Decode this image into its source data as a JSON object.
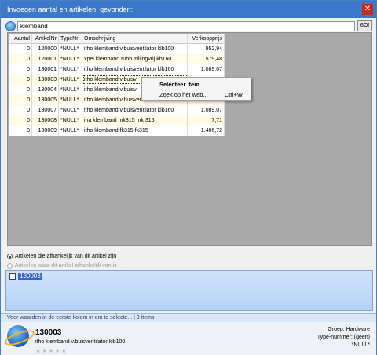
{
  "window": {
    "title": "Invoegen aantal en artikelen, gevonden:",
    "close_glyph": "✕"
  },
  "search": {
    "value": "klemband",
    "go_label": "GO!"
  },
  "table": {
    "columns": [
      "Aantal",
      "ArtikelNr",
      "TypeNr",
      "Omschrijving",
      "Verkoopprijs"
    ],
    "rows": [
      {
        "aantal": "0",
        "artikelnr": "120000",
        "typenr": "*NULL*",
        "omschrijving": "itho klemband v.buisventilator klb100",
        "prijs": "952,94"
      },
      {
        "aantal": "0",
        "artikelnr": "120001",
        "typenr": "*NULL*",
        "omschrijving": "xpel klemband rubb.trillingvrij kb160",
        "prijs": "579,48"
      },
      {
        "aantal": "0",
        "artikelnr": "130001",
        "typenr": "*NULL*",
        "omschrijving": "itho klemband v.buisventilator klb160",
        "prijs": "1.089,07"
      },
      {
        "aantal": "0",
        "artikelnr": "130003",
        "typenr": "*NULL*",
        "omschrijving": "itho klemband v.buisv",
        "prijs": ""
      },
      {
        "aantal": "0",
        "artikelnr": "130004",
        "typenr": "*NULL*",
        "omschrijving": "itho klemband v.buisv",
        "prijs": ""
      },
      {
        "aantal": "0",
        "artikelnr": "130005",
        "typenr": "*NULL*",
        "omschrijving": "itho klemband v.buisventilator klb160",
        "prijs": ""
      },
      {
        "aantal": "0",
        "artikelnr": "130007",
        "typenr": "*NULL*",
        "omschrijving": "itho klemband v.buisventilator klb160",
        "prijs": "1.089,07"
      },
      {
        "aantal": "0",
        "artikelnr": "130008",
        "typenr": "*NULL*",
        "omschrijving": "ina klemband   mk315              mk 315",
        "prijs": "7,71"
      },
      {
        "aantal": "0",
        "artikelnr": "130009",
        "typenr": "*NULL*",
        "omschrijving": "itho klemband            fk315 fk315",
        "prijs": "1.406,72"
      }
    ]
  },
  "context_menu": {
    "items": [
      {
        "label": "Selecteer item",
        "shortcut": "",
        "bold": true
      },
      {
        "label": "Zoek op het web...",
        "shortcut": "Ctrl+W",
        "bold": false
      }
    ]
  },
  "radios": {
    "option1": "Artikelen die afhankelijk van dit artikel zijn",
    "option2": "Artikelen waar dit artikel afhankelijk van is"
  },
  "listbox": {
    "item": "130003"
  },
  "status": {
    "hint": "Voer waarden in de eerste kolom in om te selecte...",
    "separator": "|",
    "count": "9 items"
  },
  "footer": {
    "code": "130003",
    "description": "itho klemband v.buisventilator klb100",
    "stars": "★★★★★",
    "group_label": "Groep: Hardware",
    "type_label": "Type-nummer: (geen)",
    "null_label": "*NULL*"
  },
  "colors": {
    "titlebar": "#3b78c9",
    "selection": "#3366cc",
    "alt_row": "#fffbe6"
  }
}
